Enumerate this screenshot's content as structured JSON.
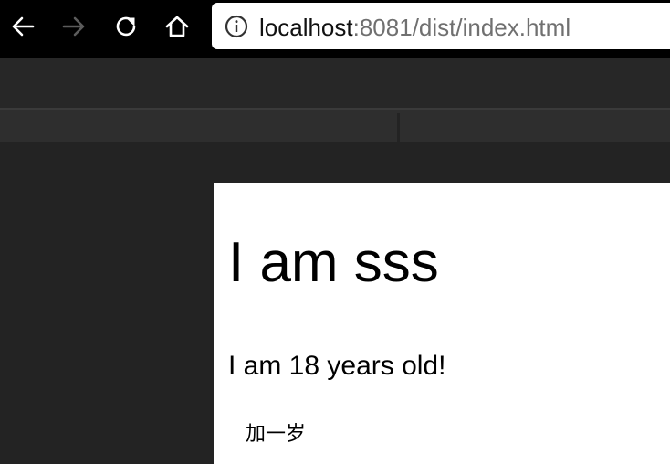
{
  "browser": {
    "url_host": "localhost",
    "url_path": ":8081/dist/index.html",
    "icons": {
      "back": "back-arrow-icon",
      "forward": "forward-arrow-icon",
      "reload": "reload-icon",
      "home": "home-icon",
      "site_info": "info-icon"
    },
    "colors": {
      "toolbar": "#000000",
      "urlbar": "#ffffff",
      "url_host": "#111111",
      "url_path": "#707070",
      "devtools_bg": "#252525"
    }
  },
  "page": {
    "heading": "I am sss",
    "paragraph": "I am 18 years old!",
    "button_label": "加一岁"
  }
}
